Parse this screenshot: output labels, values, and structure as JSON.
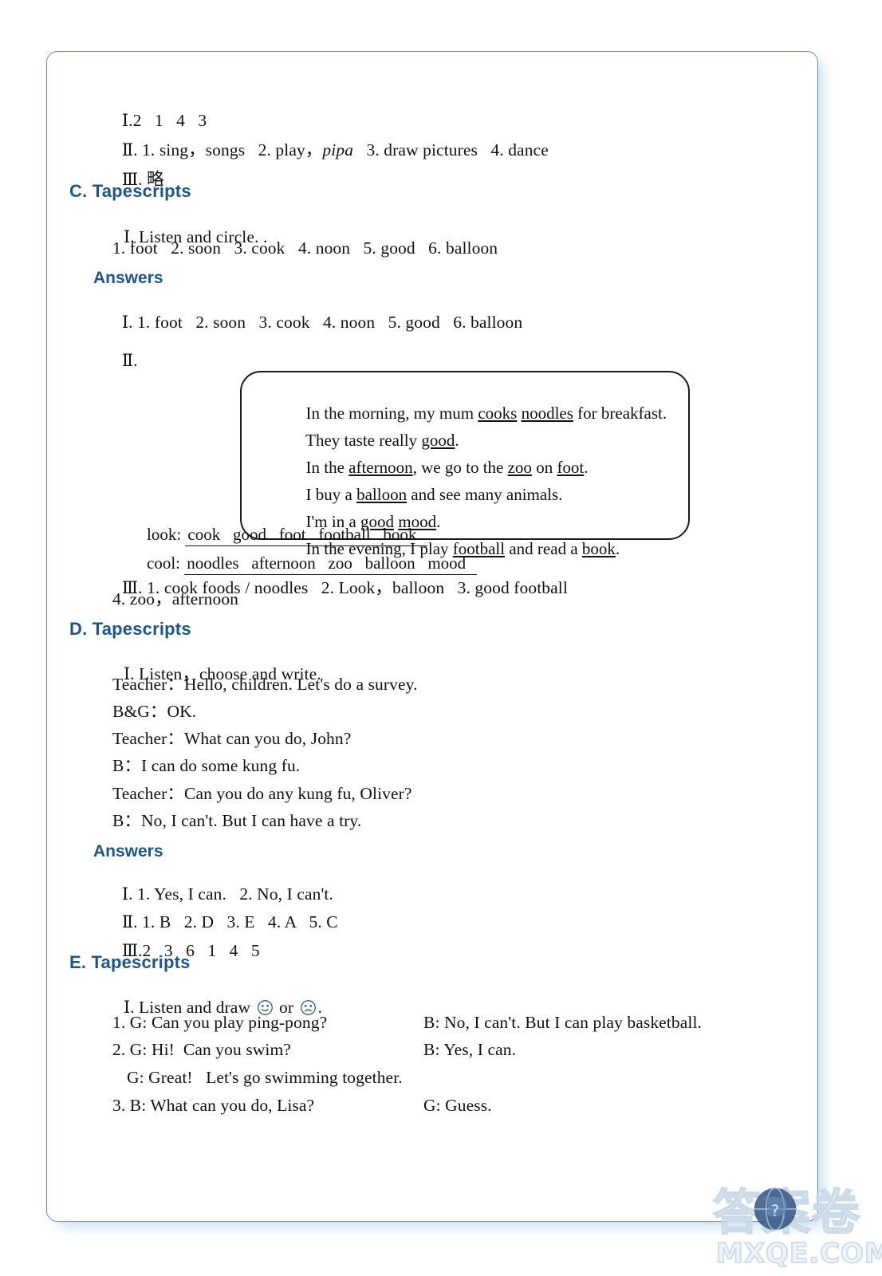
{
  "page": {
    "border_color": "#5f8fb4",
    "heading_color": "#1f5586",
    "text_color": "#111111"
  },
  "top_answers": {
    "line1": {
      "numeral": "Ⅰ",
      "text": ".2   1   4   3"
    },
    "line2": {
      "numeral": "Ⅱ",
      "text": ". 1. sing，songs   2. play，",
      "italic": "pipa",
      "rest": "   3. draw pictures   4. dance"
    },
    "line3": {
      "numeral": "Ⅲ",
      "text": ". 略"
    }
  },
  "section_c": {
    "heading": "C. Tapescripts",
    "item1": {
      "numeral": "Ⅰ",
      "text": ". Listen and circle. ."
    },
    "item1_words": "1. foot   2. soon   3. cook   4. noon   5. good   6. balloon",
    "answers_label": "Answers",
    "answer1": {
      "numeral": "Ⅰ",
      "text": ". 1. foot   2. soon   3. cook   4. noon   5. good   6. balloon"
    },
    "answer2_numeral": "Ⅱ",
    "answer2_dot": ".",
    "textbox_lines": [
      {
        "pre": "In the morning, my mum ",
        "u1": "cooks",
        "mid": " ",
        "u2": "noodles",
        "post": " for breakfast."
      },
      {
        "pre": "They taste really ",
        "u1": "good",
        "mid": "",
        "u2": "",
        "post": "."
      },
      {
        "pre": "In the ",
        "u1": "afternoon",
        "mid": ", we go to the ",
        "u2": "zoo",
        "post": " on ",
        "u3": "foot",
        "post2": "."
      },
      {
        "pre": "I buy a ",
        "u1": "balloon",
        "post": " and see many animals."
      },
      {
        "pre": "I'm in a ",
        "u1": "good",
        "mid": " ",
        "u2": "mood",
        "post": "."
      },
      {
        "pre": "In the evening, I play ",
        "u1": "football",
        "post": " and read a ",
        "u3": "book",
        "post2": "."
      }
    ],
    "fill_look_label": "look: ",
    "fill_look_value": "cook   good   foot   football   book  ",
    "fill_cool_label": "cool: ",
    "fill_cool_value": "noodles   afternoon   zoo   balloon   mood  ",
    "answer3": {
      "numeral": "Ⅲ",
      "text": ". 1. cook foods / noodles   2. Look，balloon   3. good football"
    },
    "answer3_cont": "4. zoo，afternoon"
  },
  "section_d": {
    "heading": "D. Tapescripts",
    "item1": {
      "numeral": "Ⅰ",
      "text": ". Listen，choose and write."
    },
    "dialogue": [
      "Teacher：Hello, children. Let's do a survey.",
      "B&G：OK.",
      "Teacher：What can you do, John?",
      "B：I can do some kung fu.",
      "Teacher：Can you do any kung fu, Oliver?",
      "B：No, I can't. But I can have a try."
    ],
    "answers_label": "Answers",
    "answer1": {
      "numeral": "Ⅰ",
      "text": ". 1. Yes, I can.   2. No, I can't."
    },
    "answer2": {
      "numeral": "Ⅱ",
      "text": ". 1. B   2. D   3. E   4. A   5. C"
    },
    "answer3": {
      "numeral": "Ⅲ",
      "text": ".2   3   6   1   4   5"
    }
  },
  "section_e": {
    "heading": "E. Tapescripts",
    "item1_numeral": "Ⅰ",
    "item1_pre": ". Listen and draw ",
    "item1_mid": " or ",
    "item1_post": ".",
    "smiley_icon": "smiley-face-icon",
    "frowny_icon": "frowny-face-icon",
    "rows": [
      {
        "left": "1. G: Can you play ping-pong?",
        "right": "B: No, I can't. But I can play basketball."
      },
      {
        "left": "2. G: Hi!  Can you swim?",
        "right": "B: Yes, I can."
      },
      {
        "left": "G: Great!   Let's go swimming together.",
        "right": ""
      },
      {
        "left": "3. B: What can you do, Lisa?",
        "right": "G: Guess."
      }
    ]
  },
  "watermark": {
    "chinese": "答案卷",
    "url": "MXQE.COM",
    "globe_icon": "globe-icon"
  }
}
